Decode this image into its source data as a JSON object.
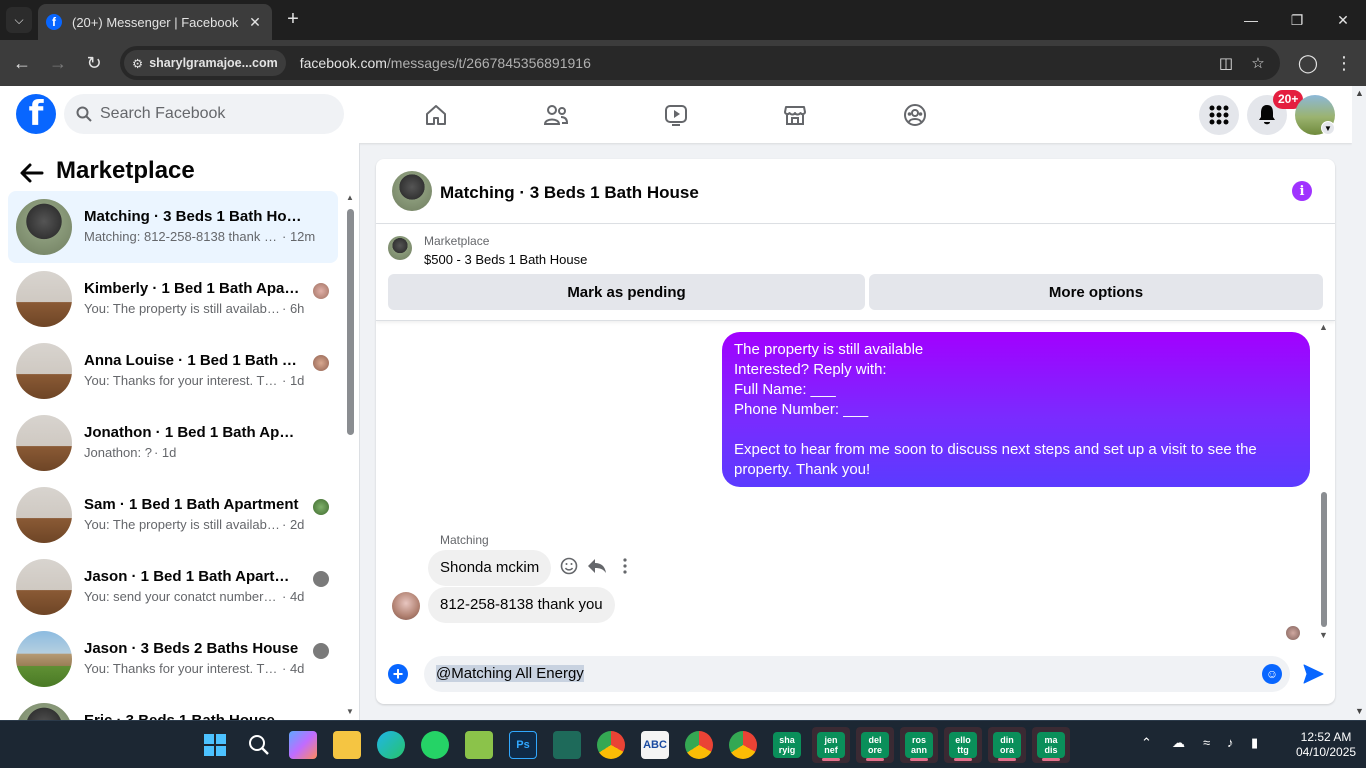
{
  "browser": {
    "tab_title": "(20+) Messenger | Facebook",
    "site_chip": "sharylgramajoe...com",
    "url_domain": "facebook.com",
    "url_path": "/messages/t/2667845356891916"
  },
  "fb": {
    "search_placeholder": "Search Facebook",
    "notification_badge": "20+",
    "brand_color": "#0866ff"
  },
  "sidebar": {
    "title": "Marketplace",
    "conversations": [
      {
        "name": "Matching · 3 Beds 1 Bath House",
        "snippet": "Matching: 812-258-8138 thank y...",
        "time": " · 12m",
        "thumb": "house-dark",
        "active": true
      },
      {
        "name": "Kimberly · 1 Bed 1 Bath Apart...",
        "snippet": "You: The property is still availabl...",
        "time": " · 6h",
        "thumb": "room1"
      },
      {
        "name": "Anna Louise · 1 Bed 1 Bath Ap...",
        "snippet": "You: Thanks for your interest. Th...",
        "time": " · 1d",
        "thumb": "room1"
      },
      {
        "name": "Jonathon · 1 Bed 1 Bath Apartme...",
        "snippet": "Jonathon: ?",
        "time": " · 1d",
        "thumb": "room1"
      },
      {
        "name": "Sam · 1 Bed 1 Bath Apartment",
        "snippet": "You: The property is still availabl...",
        "time": " · 2d",
        "thumb": "room1"
      },
      {
        "name": "Jason · 1 Bed 1 Bath Apartment",
        "snippet": "You: send your conatct number f...",
        "time": " · 4d",
        "thumb": "room1"
      },
      {
        "name": "Jason · 3 Beds 2 Baths House",
        "snippet": "You: Thanks for your interest. Th...",
        "time": " · 4d",
        "thumb": "house-green"
      },
      {
        "name": "Eric · 3 Beds 1 Bath House",
        "snippet": "",
        "time": "",
        "thumb": "house-dark"
      }
    ]
  },
  "chat": {
    "title": "Matching · 3 Beds 1 Bath House",
    "listing_source": "Marketplace",
    "listing_price": "$500 - 3 Beds 1 Bath House",
    "mark_pending_label": "Mark as pending",
    "more_options_label": "More options",
    "outgoing_message": "The property is still available\nInterested? Reply with:\nFull Name: ___\nPhone Number: ___\n\nExpect to hear from me soon to discuss next steps and set up a visit to see the property. Thank you!",
    "sender_name": "Matching",
    "incoming_1": "Shonda mckim",
    "incoming_2": "812-258-8138 thank you",
    "composer_value": "@Matching All Energy",
    "accent_gradient": [
      "#a200ff",
      "#5b3bff"
    ]
  },
  "taskbar": {
    "tiles": [
      {
        "label": "sha\nryig"
      },
      {
        "label": "jen\nnef"
      },
      {
        "label": "del\nore"
      },
      {
        "label": "ros\nann"
      },
      {
        "label": "ello\nttg"
      },
      {
        "label": "din\nora"
      },
      {
        "label": "ma\ndis"
      }
    ],
    "time": "12:52 AM",
    "date": "04/10/2025"
  }
}
